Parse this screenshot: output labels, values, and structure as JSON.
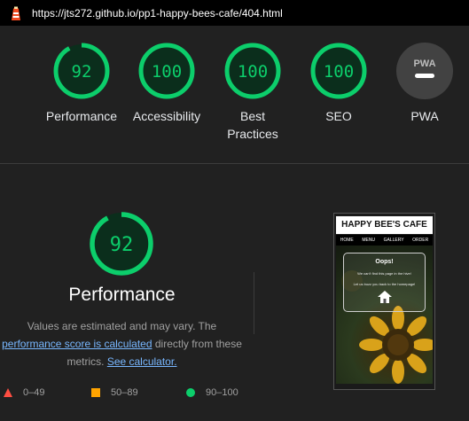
{
  "url": "https://jts272.github.io/pp1-happy-bees-cafe/404.html",
  "gauges": [
    {
      "label": "Performance",
      "score": "92"
    },
    {
      "label": "Accessibility",
      "score": "100"
    },
    {
      "label": "Best Practices",
      "score": "100"
    },
    {
      "label": "SEO",
      "score": "100"
    },
    {
      "label": "PWA",
      "score": "PWA"
    }
  ],
  "performance": {
    "score": "92",
    "title": "Performance",
    "desc_1": "Values are estimated and may vary. The",
    "link_1": "performance score is calculated",
    "desc_2": "directly from these",
    "desc_3": "metrics.",
    "link_2": "See calculator."
  },
  "legend": {
    "fail": "0–49",
    "average": "50–89",
    "pass": "90–100"
  },
  "thumbnail": {
    "site_title": "HAPPY BEE'S CAFE",
    "nav": [
      "HOME",
      "MENU",
      "GALLERY",
      "ORDER"
    ],
    "oops": "Oops!",
    "msg1": "We can't find this page in the hive!",
    "msg2": "Let us buzz you back to the homepage!"
  },
  "colors": {
    "pass": "#0cce6b",
    "average": "#ffa400",
    "fail": "#ff4e42",
    "link": "#78b7ff"
  }
}
